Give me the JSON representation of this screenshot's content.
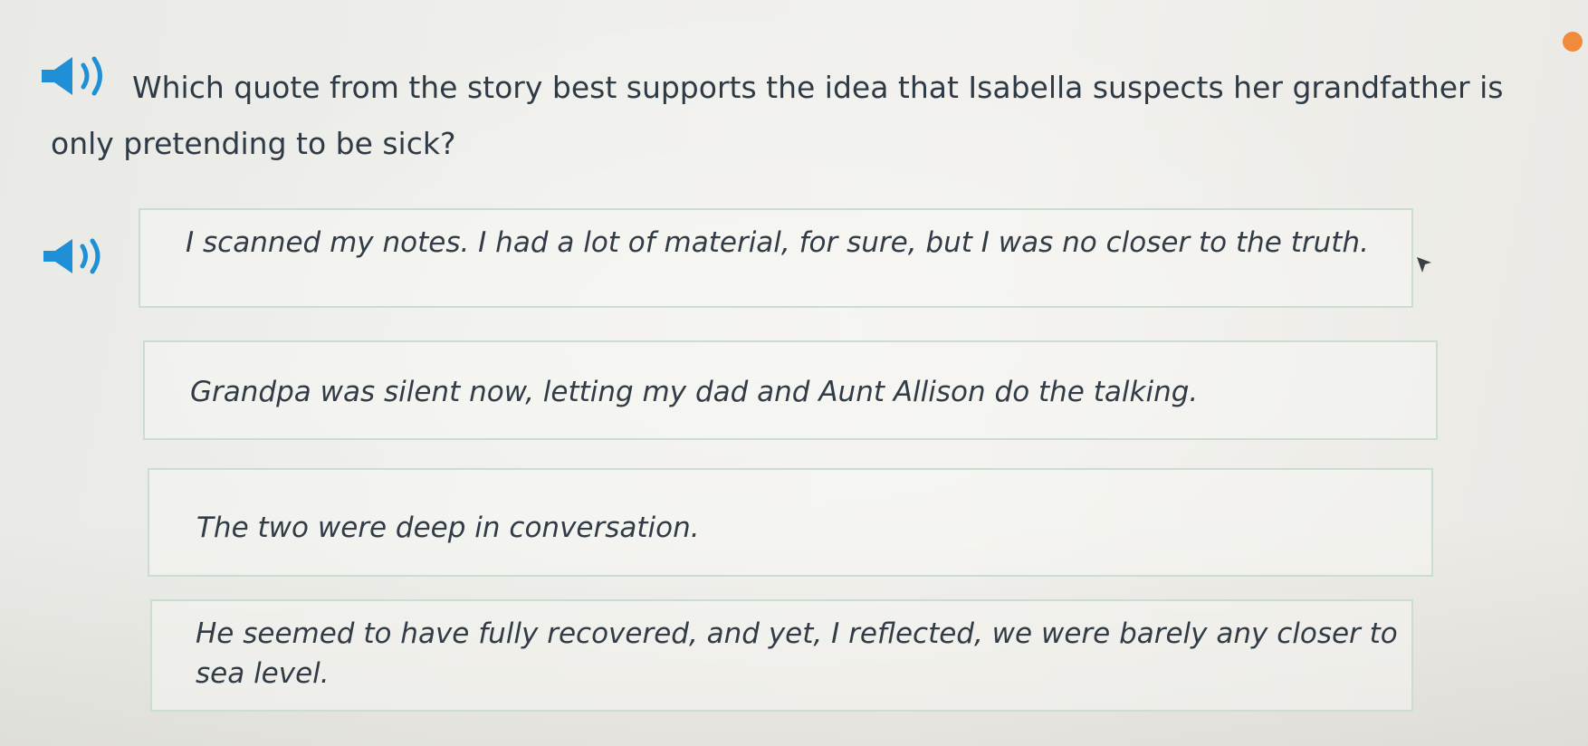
{
  "question": {
    "text": "Which quote from the story best supports the idea that Isabella suspects her grandfather is only pretending to be sick?",
    "audio_icon": "speaker-icon"
  },
  "choices": [
    {
      "text": "I scanned my notes. I had a lot of material, for sure, but I was no closer to the truth.",
      "has_audio": true
    },
    {
      "text": "Grandpa was silent now, letting my dad and Aunt Allison do the talking.",
      "has_audio": false
    },
    {
      "text": "The two were deep in conversation.",
      "has_audio": false
    },
    {
      "text": "He seemed to have fully recovered, and yet, I reflected, we were barely any closer to sea level.",
      "has_audio": false
    }
  ],
  "colors": {
    "speaker": "#1f8fd6",
    "choice_border": "#c9ddd3",
    "progress_dot": "#f08b3c",
    "text": "#2e3b46"
  },
  "icons": {
    "speaker": "speaker-icon",
    "cursor": "mouse-pointer-icon",
    "status": "orange-dot-icon"
  }
}
